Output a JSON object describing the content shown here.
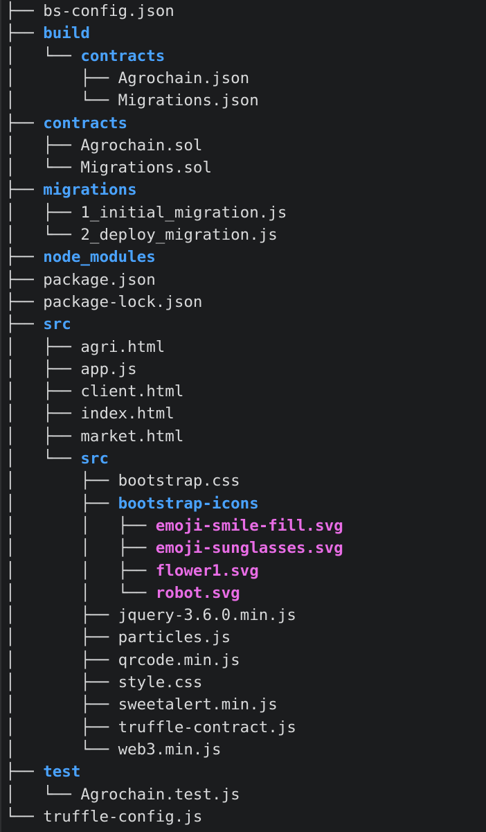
{
  "colors": {
    "background": "#1b1c1e",
    "text": "#d9dadb",
    "directory": "#4aa3ff",
    "image_file": "#e96de6"
  },
  "tree": [
    {
      "prefix": "├── ",
      "name": "bs-config.json",
      "kind": "file"
    },
    {
      "prefix": "├── ",
      "name": "build",
      "kind": "dir"
    },
    {
      "prefix": "│   └── ",
      "name": "contracts",
      "kind": "dir"
    },
    {
      "prefix": "│       ├── ",
      "name": "Agrochain.json",
      "kind": "file"
    },
    {
      "prefix": "│       └── ",
      "name": "Migrations.json",
      "kind": "file"
    },
    {
      "prefix": "├── ",
      "name": "contracts",
      "kind": "dir"
    },
    {
      "prefix": "│   ├── ",
      "name": "Agrochain.sol",
      "kind": "file"
    },
    {
      "prefix": "│   └── ",
      "name": "Migrations.sol",
      "kind": "file"
    },
    {
      "prefix": "├── ",
      "name": "migrations",
      "kind": "dir"
    },
    {
      "prefix": "│   ├── ",
      "name": "1_initial_migration.js",
      "kind": "file"
    },
    {
      "prefix": "│   └── ",
      "name": "2_deploy_migration.js",
      "kind": "file"
    },
    {
      "prefix": "├── ",
      "name": "node_modules",
      "kind": "dir"
    },
    {
      "prefix": "├── ",
      "name": "package.json",
      "kind": "file"
    },
    {
      "prefix": "├── ",
      "name": "package-lock.json",
      "kind": "file"
    },
    {
      "prefix": "├── ",
      "name": "src",
      "kind": "dir"
    },
    {
      "prefix": "│   ├── ",
      "name": "agri.html",
      "kind": "file"
    },
    {
      "prefix": "│   ├── ",
      "name": "app.js",
      "kind": "file"
    },
    {
      "prefix": "│   ├── ",
      "name": "client.html",
      "kind": "file"
    },
    {
      "prefix": "│   ├── ",
      "name": "index.html",
      "kind": "file"
    },
    {
      "prefix": "│   ├── ",
      "name": "market.html",
      "kind": "file"
    },
    {
      "prefix": "│   └── ",
      "name": "src",
      "kind": "dir"
    },
    {
      "prefix": "│       ├── ",
      "name": "bootstrap.css",
      "kind": "file"
    },
    {
      "prefix": "│       ├── ",
      "name": "bootstrap-icons",
      "kind": "dir"
    },
    {
      "prefix": "│       │   ├── ",
      "name": "emoji-smile-fill.svg",
      "kind": "image"
    },
    {
      "prefix": "│       │   ├── ",
      "name": "emoji-sunglasses.svg",
      "kind": "image"
    },
    {
      "prefix": "│       │   ├── ",
      "name": "flower1.svg",
      "kind": "image"
    },
    {
      "prefix": "│       │   └── ",
      "name": "robot.svg",
      "kind": "image"
    },
    {
      "prefix": "│       ├── ",
      "name": "jquery-3.6.0.min.js",
      "kind": "file"
    },
    {
      "prefix": "│       ├── ",
      "name": "particles.js",
      "kind": "file"
    },
    {
      "prefix": "│       ├── ",
      "name": "qrcode.min.js",
      "kind": "file"
    },
    {
      "prefix": "│       ├── ",
      "name": "style.css",
      "kind": "file"
    },
    {
      "prefix": "│       ├── ",
      "name": "sweetalert.min.js",
      "kind": "file"
    },
    {
      "prefix": "│       ├── ",
      "name": "truffle-contract.js",
      "kind": "file"
    },
    {
      "prefix": "│       └── ",
      "name": "web3.min.js",
      "kind": "file"
    },
    {
      "prefix": "├── ",
      "name": "test",
      "kind": "dir"
    },
    {
      "prefix": "│   └── ",
      "name": "Agrochain.test.js",
      "kind": "file"
    },
    {
      "prefix": "└── ",
      "name": "truffle-config.js",
      "kind": "file"
    }
  ]
}
